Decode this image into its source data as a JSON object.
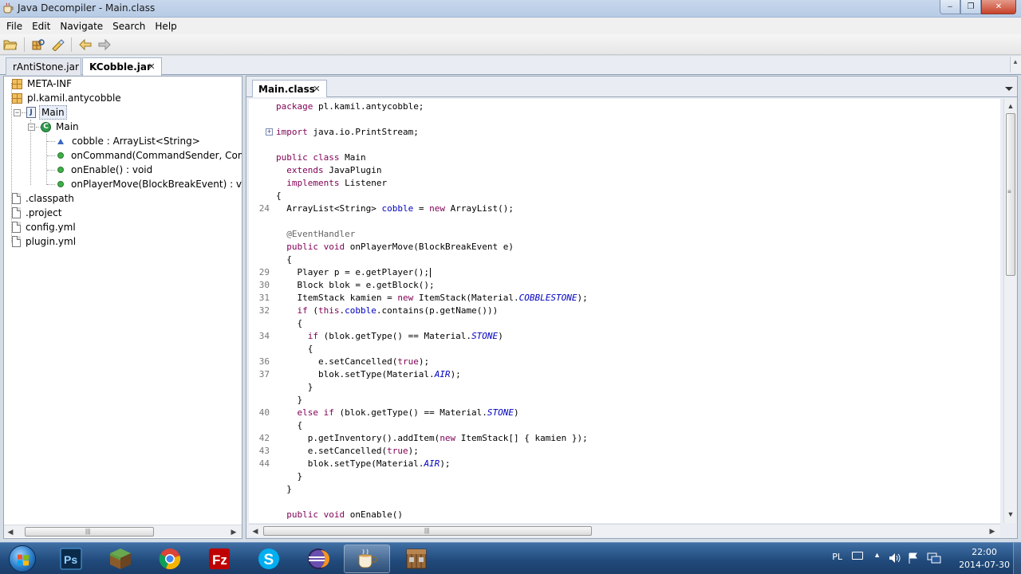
{
  "window": {
    "title": "Java Decompiler - Main.class"
  },
  "menu": [
    "File",
    "Edit",
    "Navigate",
    "Search",
    "Help"
  ],
  "jar_tabs": [
    {
      "label": "rAntiStone.jar",
      "active": false
    },
    {
      "label": "KCobble.jar",
      "active": true
    }
  ],
  "tree": {
    "meta_inf": "META-INF",
    "package": "pl.kamil.antycobble",
    "file": "Main",
    "class": "Main",
    "members": [
      {
        "label": "cobble : ArrayList<String>",
        "kind": "field"
      },
      {
        "label": "onCommand(CommandSender, Command, String, String[]) : boolean",
        "kind": "method"
      },
      {
        "label": "onEnable() : void",
        "kind": "method"
      },
      {
        "label": "onPlayerMove(BlockBreakEvent) : void",
        "kind": "method"
      }
    ],
    "files": [
      ".classpath",
      ".project",
      "config.yml",
      "plugin.yml"
    ]
  },
  "editor": {
    "tab_label": "Main.class",
    "line_numbers": [
      "24",
      "29",
      "30",
      "31",
      "32",
      "34",
      "36",
      "37",
      "40",
      "42",
      "43",
      "44"
    ]
  },
  "taskbar": {
    "apps": [
      "windows-explorer",
      "photoshop",
      "minecraft",
      "chrome",
      "filezilla",
      "skype",
      "eclipse",
      "java-decompiler",
      "minecraft-launcher"
    ],
    "language": "PL",
    "time": "22:00",
    "date": "2014-07-30"
  }
}
